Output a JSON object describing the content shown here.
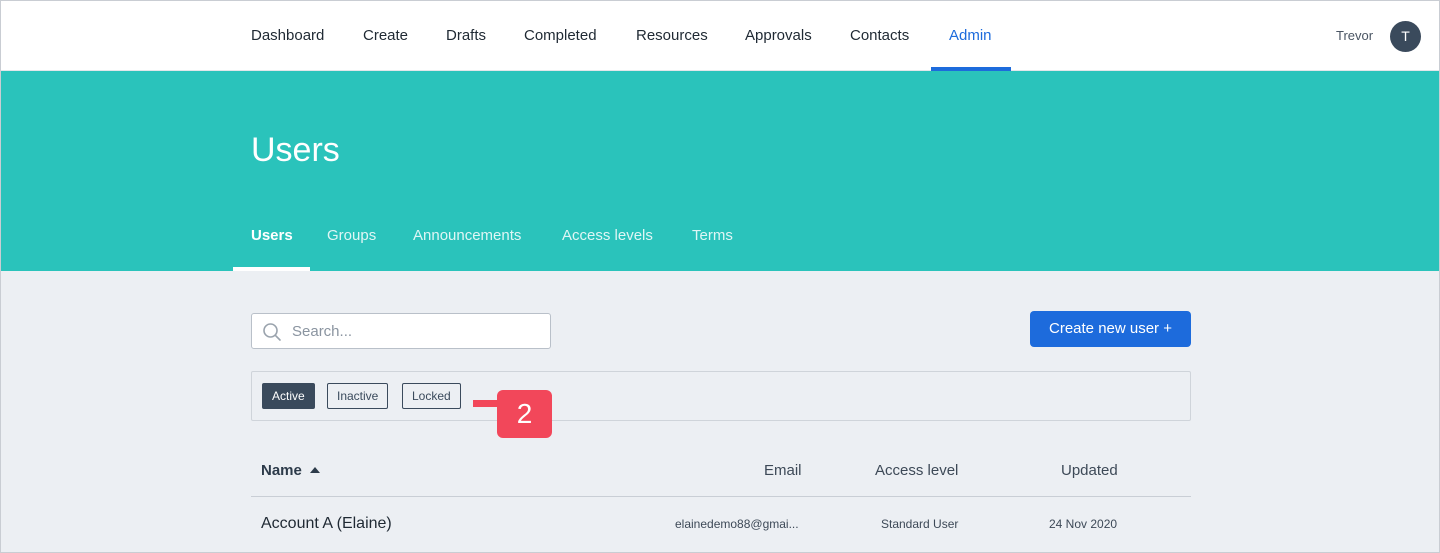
{
  "nav": {
    "items": [
      {
        "label": "Dashboard"
      },
      {
        "label": "Create"
      },
      {
        "label": "Drafts"
      },
      {
        "label": "Completed"
      },
      {
        "label": "Resources"
      },
      {
        "label": "Approvals"
      },
      {
        "label": "Contacts"
      },
      {
        "label": "Admin",
        "active": true
      }
    ],
    "user_name": "Trevor",
    "avatar_initial": "T"
  },
  "header": {
    "title": "Users",
    "tabs": [
      {
        "label": "Users",
        "active": true
      },
      {
        "label": "Groups"
      },
      {
        "label": "Announcements"
      },
      {
        "label": "Access levels"
      },
      {
        "label": "Terms"
      }
    ]
  },
  "search": {
    "placeholder": "Search...",
    "value": ""
  },
  "create_button": {
    "label": "Create new user +"
  },
  "filters": [
    {
      "label": "Active",
      "active": true
    },
    {
      "label": "Inactive"
    },
    {
      "label": "Locked"
    }
  ],
  "callout": {
    "label": "2"
  },
  "table": {
    "columns": {
      "name": "Name",
      "email": "Email",
      "access": "Access level",
      "updated": "Updated"
    },
    "rows": [
      {
        "name": "Account A (Elaine)",
        "email": "elainedemo88@gmai...",
        "access": "Standard User",
        "updated": "24 Nov 2020"
      }
    ]
  },
  "colors": {
    "accent": "#1d6bdc",
    "teal": "#2ac3bb",
    "callout": "#f2475a",
    "dark": "#3a4a5c"
  }
}
